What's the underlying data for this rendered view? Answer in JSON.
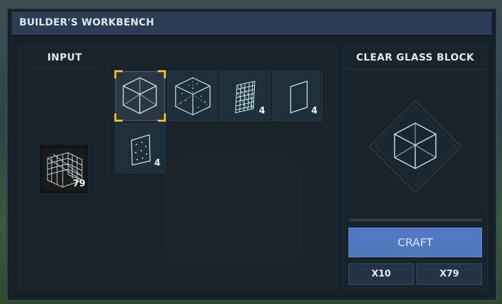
{
  "window": {
    "title": "BUILDER'S WORKBENCH"
  },
  "input": {
    "header": "INPUT",
    "inventory_slot": {
      "icon": "glass-pane-stack-icon",
      "count": "79"
    }
  },
  "recipes": [
    {
      "icon": "clear-glass-block-icon",
      "count": "",
      "selected": true
    },
    {
      "icon": "dotted-glass-block-icon",
      "count": "",
      "selected": false
    },
    {
      "icon": "lattice-glass-panel-icon",
      "count": "4",
      "selected": false
    },
    {
      "icon": "clear-glass-pane-icon",
      "count": "4",
      "selected": false
    },
    {
      "icon": "dotted-glass-panel-icon",
      "count": "4",
      "selected": false
    }
  ],
  "output": {
    "title": "CLEAR GLASS BLOCK",
    "preview_icon": "clear-glass-block-icon",
    "progress": 0,
    "craft_label": "CRAFT",
    "qty_buttons": [
      "X10",
      "X79"
    ]
  },
  "colors": {
    "accent_selected": "#f2b43c",
    "craft_button": "#5678c6",
    "glass_line": "#bfe8f2"
  }
}
